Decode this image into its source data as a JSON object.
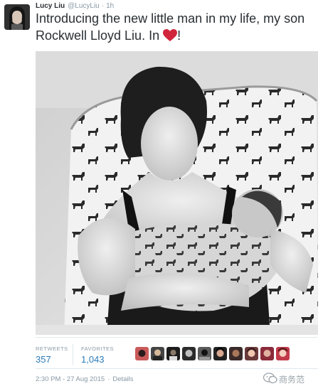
{
  "tweet": {
    "author": {
      "name": "Lucy Liu",
      "handle": "@LucyLiu",
      "separator": "·",
      "age": "1h"
    },
    "text_part1": "Introducing the new little man in my life, my son Rockwell Lloyd Liu. In ",
    "text_emoji": "heart-emoji",
    "text_part2": "!",
    "photo_icon": "photo-black-and-white"
  },
  "stats": {
    "retweets_label": "RETWEETS",
    "retweets_value": "357",
    "favorites_label": "FAVORITES",
    "favorites_value": "1,043",
    "favoriter_avatar_count": 10
  },
  "footer": {
    "timestamp": "2:30 PM - 27 Aug 2015",
    "separator": "·",
    "details_link": "Details"
  },
  "watermark": {
    "text": "商务范",
    "icon": "wechat-icon"
  },
  "colors": {
    "text": "#292f33",
    "muted": "#8899a6",
    "link": "#2b7bb9",
    "heart": "#d0253a",
    "divider": "#e1e8ed"
  }
}
